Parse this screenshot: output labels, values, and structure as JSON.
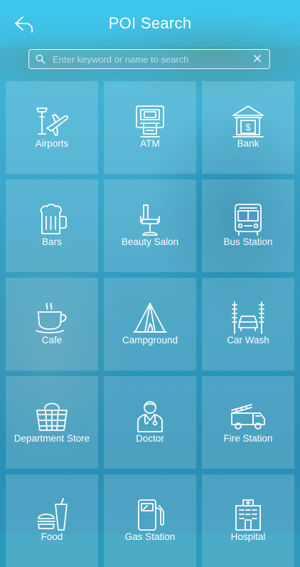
{
  "header": {
    "title": "POI Search"
  },
  "search": {
    "placeholder": "Enter keyword or name to search",
    "value": ""
  },
  "categories": [
    {
      "label": "Airports",
      "icon": "airport-icon"
    },
    {
      "label": "ATM",
      "icon": "atm-icon"
    },
    {
      "label": "Bank",
      "icon": "bank-icon"
    },
    {
      "label": "Bars",
      "icon": "beer-mug-icon"
    },
    {
      "label": "Beauty Salon",
      "icon": "salon-chair-icon"
    },
    {
      "label": "Bus Station",
      "icon": "bus-icon"
    },
    {
      "label": "Cafe",
      "icon": "coffee-cup-icon"
    },
    {
      "label": "Campground",
      "icon": "tent-icon"
    },
    {
      "label": "Car Wash",
      "icon": "car-wash-icon"
    },
    {
      "label": "Department Store",
      "icon": "basket-icon"
    },
    {
      "label": "Doctor",
      "icon": "doctor-icon"
    },
    {
      "label": "Fire Station",
      "icon": "fire-truck-icon"
    },
    {
      "label": "Food",
      "icon": "fast-food-icon"
    },
    {
      "label": "Gas Station",
      "icon": "gas-pump-icon"
    },
    {
      "label": "Hospital",
      "icon": "hospital-icon"
    }
  ]
}
